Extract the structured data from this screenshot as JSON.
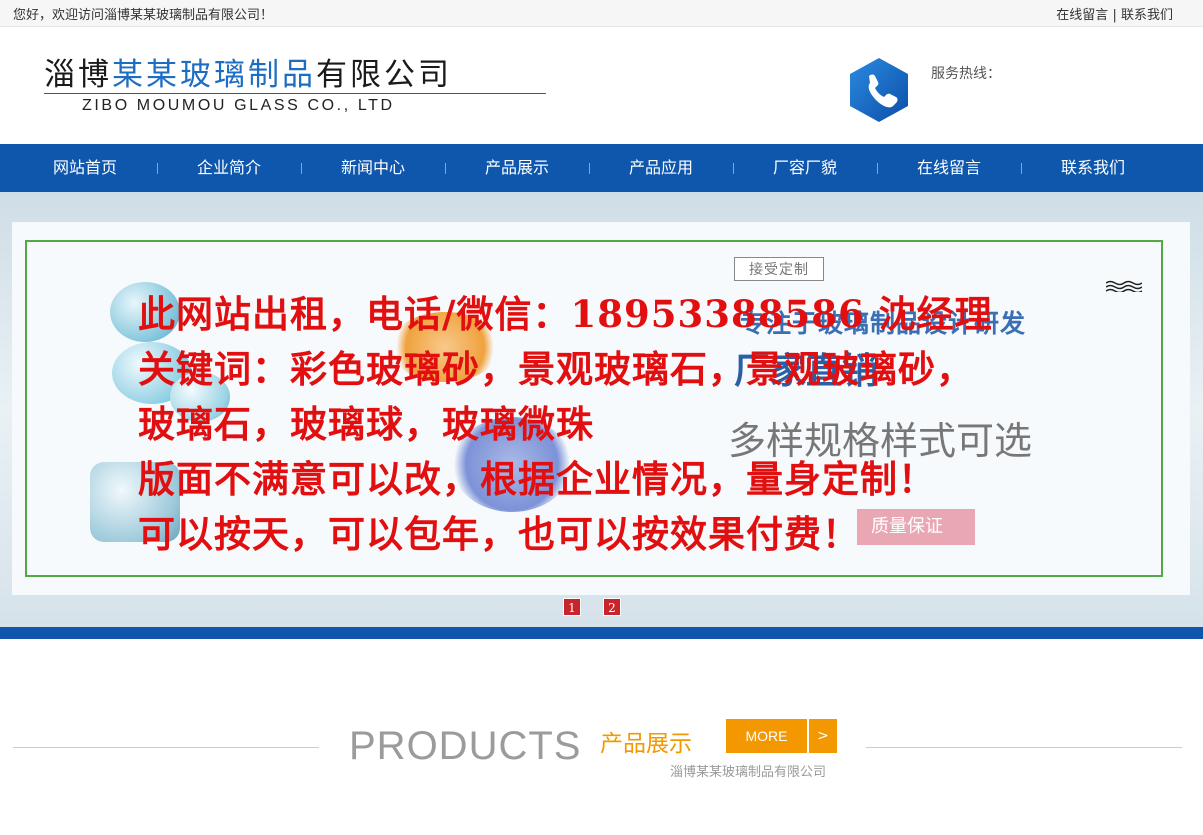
{
  "topbar": {
    "welcome": "您好，欢迎访问淄博某某玻璃制品有限公司！",
    "link_message": "在线留言",
    "separator": "|",
    "link_contact": "联系我们"
  },
  "header": {
    "logo_cn_part1": "淄博",
    "logo_cn_part2": "某某玻璃制品",
    "logo_cn_part3": "有限公司",
    "logo_en": "ZIBO MOUMOU GLASS CO., LTD",
    "hotline_label": "服务热线：",
    "phone_icon": "phone-icon"
  },
  "nav": {
    "items": [
      "网站首页",
      "企业简介",
      "新闻中心",
      "产品展示",
      "产品应用",
      "厂容厂貌",
      "在线留言",
      "联系我们"
    ]
  },
  "banner": {
    "bg_badge": "接受定制",
    "bg_slogan": "专注于玻璃制品设计研发",
    "bg_big": "厂家直销",
    "bg_options": "多样规格样式可选",
    "bg_quality": "质量保证",
    "ad_lines": [
      "此网站出租，电话/微信：18953388586  沈经理",
      "关键词：彩色玻璃砂，景观玻璃石，景观玻璃砂，",
      "玻璃石，玻璃球，玻璃微珠",
      "版面不满意可以改，根据企业情况，量身定制！",
      "可以按天，可以包年，也可以按效果付费！"
    ],
    "slide_dots": [
      "1",
      "2"
    ]
  },
  "products": {
    "title_en": "PRODUCTS",
    "title_cn": "产品展示",
    "more_label": "MORE",
    "more_arrow": ">",
    "subtitle": "淄博某某玻璃制品有限公司"
  },
  "colors": {
    "nav_blue": "#0e57ad",
    "ad_red": "#e10f0f",
    "accent_orange": "#f39800",
    "frame_green": "#53a846"
  }
}
